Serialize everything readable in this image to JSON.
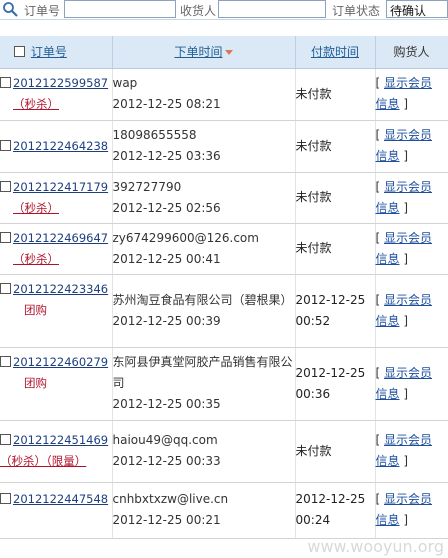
{
  "search": {
    "order_label": "订单号",
    "order_value": "",
    "consignee_label": "收货人",
    "consignee_value": "",
    "status_label": "订单状态",
    "status_value": "待确认"
  },
  "table": {
    "headers": {
      "order_no": "订单号",
      "order_time": "下单时间",
      "pay_time": "付款时间",
      "buyer": "购货人"
    },
    "rows": [
      {
        "order_no": "2012122599587",
        "tag": "（秒杀）",
        "buyer": "wap",
        "order_time": "2012-12-25 08:21",
        "pay": "未付款",
        "info1": "显示会员",
        "info2": "信息"
      },
      {
        "order_no": "2012122464238",
        "tag": "",
        "buyer": "18098655558",
        "order_time": "2012-12-25 03:36",
        "pay": "未付款",
        "info1": "显示会员",
        "info2": "信息"
      },
      {
        "order_no": "2012122417179",
        "tag": "（秒杀）",
        "buyer": "392727790",
        "order_time": "2012-12-25 02:56",
        "pay": "未付款",
        "info1": "显示会员",
        "info2": "信息"
      },
      {
        "order_no": "2012122469647",
        "tag": "（秒杀）",
        "buyer": "zy674299600@126.com",
        "order_time": "2012-12-25 00:41",
        "pay": "未付款",
        "info1": "显示会员",
        "info2": "信息"
      },
      {
        "order_no": "2012122423346",
        "tag": "团购",
        "buyer": "苏州淘豆食品有限公司（碧根果）",
        "order_time": "2012-12-25 00:39",
        "pay_date": "2012-12-25",
        "pay_time": "00:52",
        "info1": "显示会员",
        "info2": "信息"
      },
      {
        "order_no": "2012122460279",
        "tag": "团购",
        "buyer": "东阿县伊真堂阿胶产品销售有限公司",
        "order_time": "2012-12-25 00:35",
        "pay_date": "2012-12-25",
        "pay_time": "00:36",
        "info1": "显示会员",
        "info2": "信息"
      },
      {
        "order_no": "2012122451469",
        "tag": "（秒杀）（限量）",
        "buyer": "haiou49@qq.com",
        "order_time": "2012-12-25 00:33",
        "pay": "未付款",
        "info1": "显示会员",
        "info2": "信息"
      },
      {
        "order_no": "2012122447548",
        "tag": "",
        "buyer": "cnhbxtxzw@live.cn",
        "order_time": "2012-12-25 00:21",
        "pay_date": "2012-12-25",
        "pay_time": "00:24",
        "info1": "显示会员",
        "info2": "信息"
      }
    ]
  },
  "watermark": "www.wooyun.org"
}
